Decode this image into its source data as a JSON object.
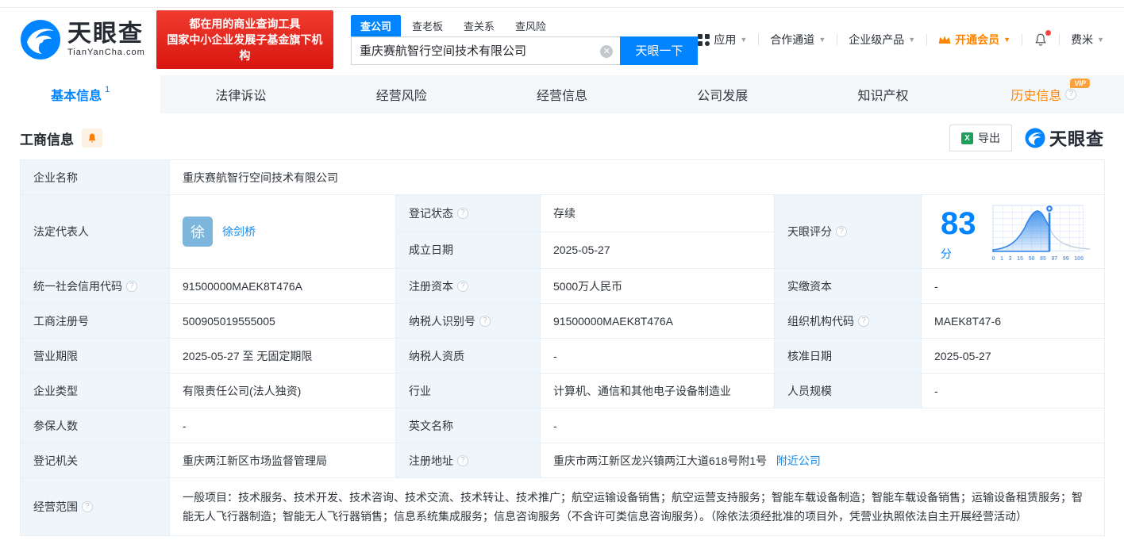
{
  "brand": {
    "name": "天眼查",
    "domain": "TianYanCha.com",
    "slogan_line1": "都在用的商业查询工具",
    "slogan_line2": "国家中小企业发展子基金旗下机构",
    "accent_color": "#0084ff",
    "badge_color": "#e8261d"
  },
  "search": {
    "tabs": [
      "查公司",
      "查老板",
      "查关系",
      "查风险"
    ],
    "value": "重庆赛航智行空间技术有限公司",
    "button": "天眼一下"
  },
  "nav": {
    "apps": "应用",
    "partner": "合作通道",
    "enterprise": "企业级产品",
    "vip": "开通会员",
    "user": "费米"
  },
  "tabs": {
    "items": [
      "基本信息",
      "法律诉讼",
      "经营风险",
      "经营信息",
      "公司发展",
      "知识产权",
      "历史信息"
    ],
    "active_badge": "1",
    "vip_badge": "VIP"
  },
  "section": {
    "title": "工商信息",
    "export_label": "导出",
    "watermark": "天眼查"
  },
  "score": {
    "label": "天眼评分",
    "value": "83",
    "unit": "分",
    "axis": [
      "0",
      "1",
      "3",
      "15",
      "50",
      "85",
      "97",
      "99",
      "100"
    ]
  },
  "info": {
    "company_name": {
      "label": "企业名称",
      "value": "重庆赛航智行空间技术有限公司"
    },
    "legal_rep": {
      "label": "法定代表人",
      "avatar_char": "徐",
      "name": "徐剑桥"
    },
    "reg_status": {
      "label": "登记状态",
      "value": "存续"
    },
    "establish_date": {
      "label": "成立日期",
      "value": "2025-05-27"
    },
    "credit_code": {
      "label": "统一社会信用代码",
      "value": "91500000MAEK8T476A"
    },
    "reg_capital": {
      "label": "注册资本",
      "value": "5000万人民币"
    },
    "paid_capital": {
      "label": "实缴资本",
      "value": "-"
    },
    "reg_number": {
      "label": "工商注册号",
      "value": "500905019555005"
    },
    "taxpayer_id": {
      "label": "纳税人识别号",
      "value": "91500000MAEK8T476A"
    },
    "org_code": {
      "label": "组织机构代码",
      "value": "MAEK8T47-6"
    },
    "business_term": {
      "label": "营业期限",
      "value": "2025-05-27 至 无固定期限"
    },
    "taxpayer_quality": {
      "label": "纳税人资质",
      "value": "-"
    },
    "approval_date": {
      "label": "核准日期",
      "value": "2025-05-27"
    },
    "company_type": {
      "label": "企业类型",
      "value": "有限责任公司(法人独资)"
    },
    "industry": {
      "label": "行业",
      "value": "计算机、通信和其他电子设备制造业"
    },
    "staff_size": {
      "label": "人员规模",
      "value": "-"
    },
    "insured_count": {
      "label": "参保人数",
      "value": "-"
    },
    "english_name": {
      "label": "英文名称",
      "value": "-"
    },
    "reg_authority": {
      "label": "登记机关",
      "value": "重庆两江新区市场监督管理局"
    },
    "reg_address": {
      "label": "注册地址",
      "value": "重庆市两江新区龙兴镇两江大道618号附1号",
      "nearby_link": "附近公司"
    },
    "business_scope": {
      "label": "经营范围",
      "value": "一般项目：技术服务、技术开发、技术咨询、技术交流、技术转让、技术推广；航空运输设备销售；航空运营支持服务；智能车载设备制造；智能车载设备销售；运输设备租赁服务；智能无人飞行器制造；智能无人飞行器销售；信息系统集成服务；信息咨询服务（不含许可类信息咨询服务）。（除依法须经批准的项目外，凭营业执照依法自主开展经营活动）"
    }
  }
}
